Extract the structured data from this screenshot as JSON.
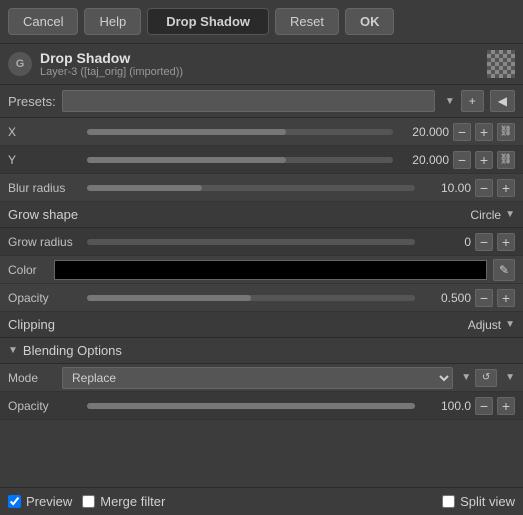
{
  "toolbar": {
    "cancel": "Cancel",
    "help": "Help",
    "title": "Drop Shadow",
    "reset": "Reset",
    "ok": "OK"
  },
  "header": {
    "icon_label": "G",
    "title": "Drop Shadow",
    "subtitle": "Layer-3 ([taj_orig] (imported))"
  },
  "presets": {
    "label": "Presets:",
    "placeholder": "",
    "add_icon": "+",
    "menu_icon": "☰"
  },
  "fields": {
    "x": {
      "label": "X",
      "value": "20.000",
      "fill_pct": 65
    },
    "y": {
      "label": "Y",
      "value": "20.000",
      "fill_pct": 65
    },
    "blur_radius": {
      "label": "Blur radius",
      "value": "10.00",
      "fill_pct": 35
    },
    "grow_shape": {
      "label": "Grow shape",
      "value": "Circle"
    },
    "grow_radius": {
      "label": "Grow radius",
      "value": "0",
      "fill_pct": 0
    },
    "color": {
      "label": "Color"
    },
    "opacity": {
      "label": "Opacity",
      "value": "0.500",
      "fill_pct": 50
    },
    "clipping": {
      "label": "Clipping",
      "value": "Adjust"
    },
    "blending_options": {
      "label": "Blending Options"
    },
    "mode": {
      "label": "Mode",
      "value": "Replace"
    },
    "blend_opacity": {
      "label": "Opacity",
      "value": "100.0",
      "fill_pct": 100
    }
  },
  "bottom": {
    "preview_label": "Preview",
    "merge_filter_label": "Merge filter",
    "split_view_label": "Split view"
  }
}
